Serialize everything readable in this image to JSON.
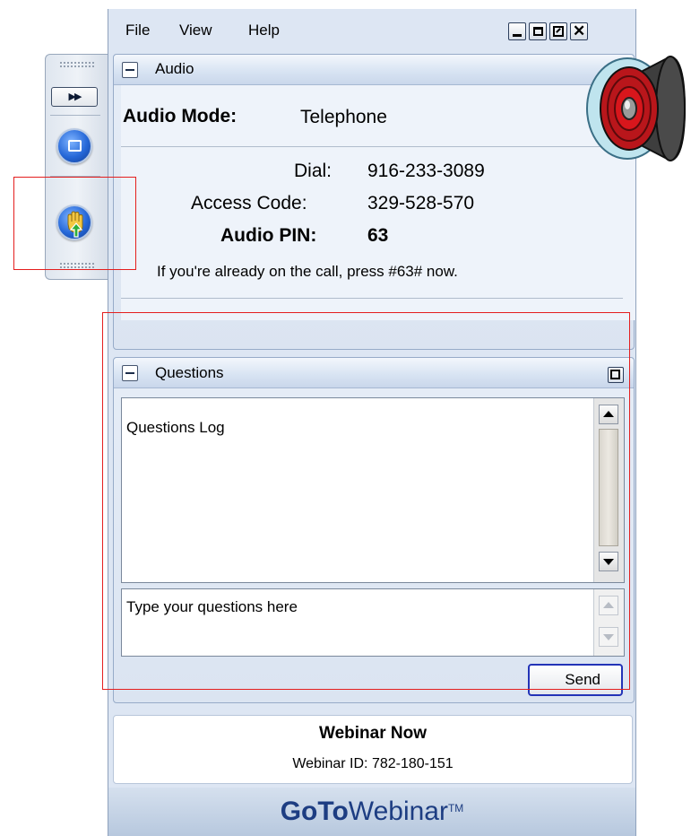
{
  "menu": {
    "file": "File",
    "view": "View",
    "help": "Help"
  },
  "audio_panel": {
    "title": "Audio",
    "mode_label": "Audio Mode:",
    "mode_value": "Telephone",
    "dial_label": "Dial:",
    "dial_value": "916-233-3089",
    "access_label": "Access Code:",
    "access_value": "329-528-570",
    "pin_label": "Audio PIN:",
    "pin_value": "63",
    "note": "If you're already on the call, press #63# now."
  },
  "questions_panel": {
    "title": "Questions",
    "log_text": "Questions Log",
    "input_placeholder": "Type your questions here",
    "send_label": "Send"
  },
  "webinar": {
    "name": "Webinar Now",
    "id_line": "Webinar ID: 782-180-151"
  },
  "brand": {
    "goto": "GoTo",
    "webinar": "Webinar",
    "tm": "TM"
  },
  "colors": {
    "highlight": "#e41e1e",
    "speaker_red": "#d8161c",
    "brand_blue": "#1d3d82"
  }
}
